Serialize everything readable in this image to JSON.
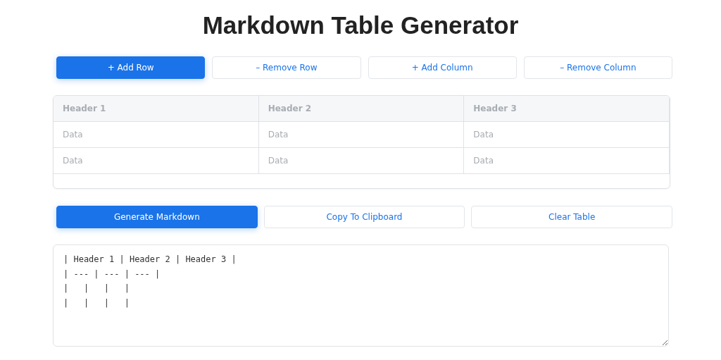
{
  "title": "Markdown Table Generator",
  "edit_buttons": [
    {
      "label": "+ Add Row",
      "kind": "primary"
    },
    {
      "label": "– Remove Row",
      "kind": "secondary"
    },
    {
      "label": "+ Add Column",
      "kind": "secondary"
    },
    {
      "label": "– Remove Column",
      "kind": "secondary"
    }
  ],
  "table": {
    "headers": [
      {
        "placeholder": "Header 1"
      },
      {
        "placeholder": "Header 2"
      },
      {
        "placeholder": "Header 3"
      }
    ],
    "rows": [
      [
        {
          "placeholder": "Data"
        },
        {
          "placeholder": "Data"
        },
        {
          "placeholder": "Data"
        }
      ],
      [
        {
          "placeholder": "Data"
        },
        {
          "placeholder": "Data"
        },
        {
          "placeholder": "Data"
        }
      ]
    ]
  },
  "action_buttons": [
    {
      "label": "Generate Markdown",
      "kind": "primary"
    },
    {
      "label": "Copy To Clipboard",
      "kind": "secondary"
    },
    {
      "label": "Clear Table",
      "kind": "secondary"
    }
  ],
  "output": {
    "lines": [
      "| Header 1 | Header 2 | Header 3 |",
      "| --- | --- | --- |",
      "|   |   |   |",
      "|   |   |   |"
    ]
  }
}
